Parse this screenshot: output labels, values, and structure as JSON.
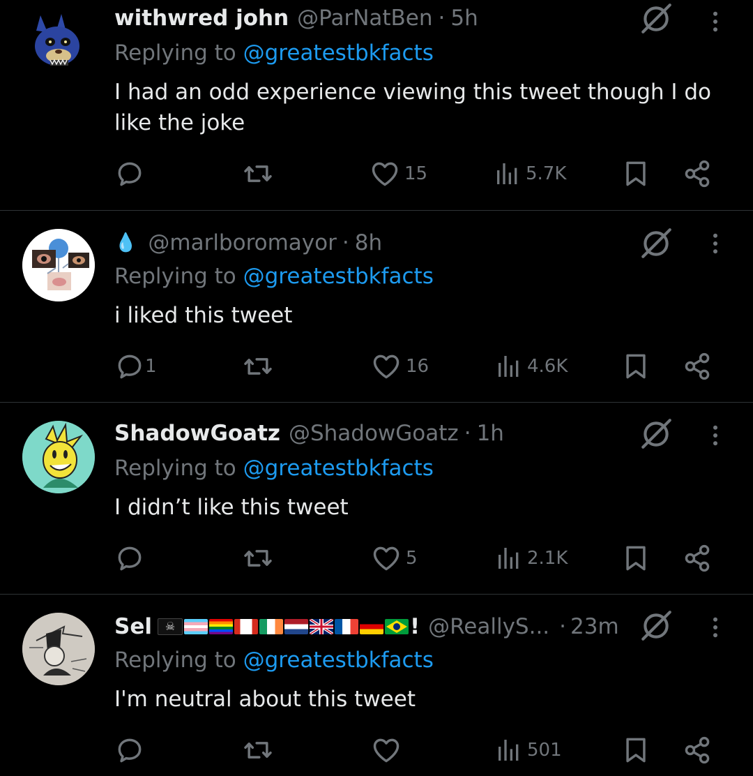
{
  "colors": {
    "background": "#000000",
    "text": "#e7e9ea",
    "muted": "#71767b",
    "link": "#1d9bf0",
    "divider": "#2f3336"
  },
  "icons": {
    "reply": "reply-icon",
    "retweet": "retweet-icon",
    "like": "heart-icon",
    "views": "views-icon",
    "bookmark": "bookmark-icon",
    "share": "share-icon",
    "grok": "grok-icon",
    "more": "more-icon"
  },
  "tweets": [
    {
      "name": "withwred john",
      "handle": "@ParNatBen",
      "separator": "·",
      "time": "5h",
      "replying_label": "Replying to ",
      "replying_to": "@greatestbkfacts",
      "text": "I had an odd experience viewing this tweet though I do like the joke",
      "replies": "",
      "likes": "15",
      "views": "5.7K"
    },
    {
      "name": "💧",
      "handle": "@marlboromayor",
      "separator": "·",
      "time": "8h",
      "replying_label": "Replying to ",
      "replying_to": "@greatestbkfacts",
      "text": "i liked this tweet",
      "replies": "1",
      "likes": "16",
      "views": "4.6K"
    },
    {
      "name": "ShadowGoatz",
      "handle": "@ShadowGoatz",
      "separator": "·",
      "time": "1h",
      "replying_label": "Replying to ",
      "replying_to": "@greatestbkfacts",
      "text": "I didn’t like this tweet",
      "replies": "",
      "likes": "5",
      "views": "2.1K"
    },
    {
      "name": "Sel",
      "name_suffix": "!",
      "flags": [
        "pirate",
        "trans",
        "pride",
        "canada",
        "ireland",
        "netherlands",
        "uk",
        "france",
        "germany",
        "brazil"
      ],
      "handle": "@ReallyS...",
      "separator": "·",
      "time": "23m",
      "replying_label": "Replying to ",
      "replying_to": "@greatestbkfacts",
      "text": "I'm neutral about this tweet",
      "replies": "",
      "likes": "",
      "views": "501"
    }
  ]
}
